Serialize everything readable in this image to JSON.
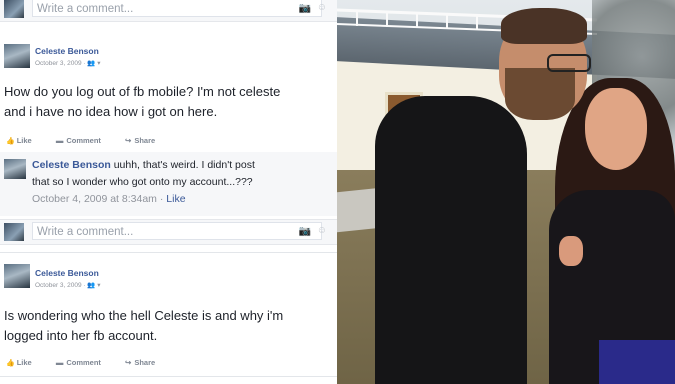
{
  "write_comment_placeholder": "Write a comment...",
  "posts": [
    {
      "author": "Celeste Benson",
      "meta": "October 3, 2009 · 👥 ▾",
      "text_line1": "How do you log out of fb mobile? I'm not celeste",
      "text_line2": "and i have no idea how i got on here.",
      "actions": [
        "Like",
        "Comment",
        "Share"
      ]
    },
    {
      "author": "Celeste Benson",
      "meta": "October 3, 2009 · 👥 ▾",
      "text_line1": "Is wondering who the hell Celeste is and why i'm",
      "text_line2": "logged into her fb account.",
      "actions": [
        "Like",
        "Comment",
        "Share"
      ]
    }
  ],
  "comment": {
    "author": "Celeste Benson",
    "text_line1": "uuhh, that's weird. I didn't post",
    "text_line2": "that so I wonder who got onto my account...???",
    "timestamp": "October 4, 2009 at 8:34am",
    "like_label": "Like"
  },
  "icons": {
    "camera": "📷",
    "emoji": "☺",
    "like": "👍",
    "comment": "▬",
    "share": "↪"
  }
}
